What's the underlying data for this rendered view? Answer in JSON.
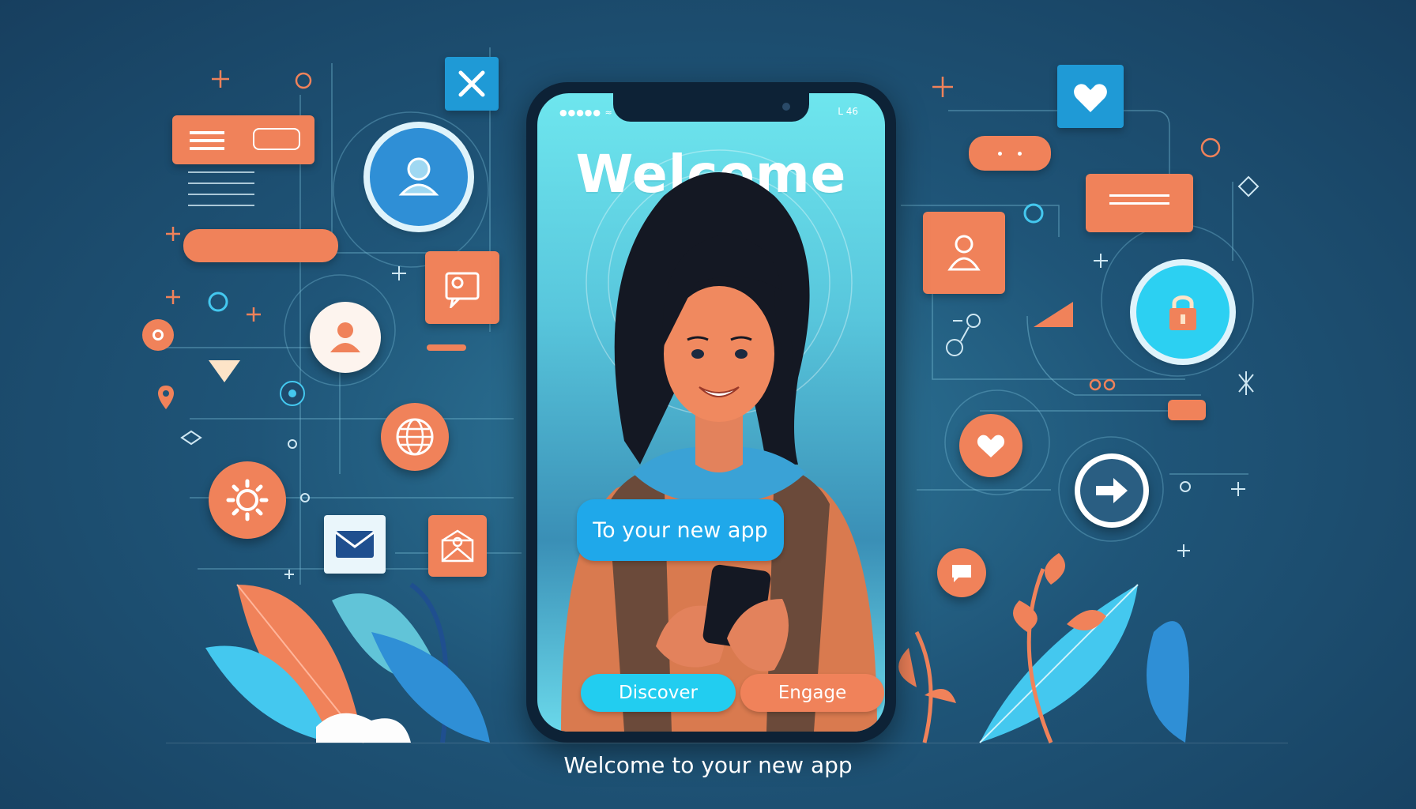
{
  "screen": {
    "title": "Welcome",
    "status_left": "●●●●● ≈",
    "status_right": "L 46",
    "bubble_text": "To your new app",
    "buttons": {
      "discover": "Discover",
      "engage": "Engage"
    }
  },
  "caption": "Welcome to your new app",
  "icons": [
    "close-icon",
    "user-icon",
    "chat-icon",
    "mail-icon",
    "envelope-icon",
    "settings-icon",
    "globe-icon",
    "location-pin-icon",
    "heart-icon",
    "lock-icon",
    "arrow-right-icon",
    "profile-icon",
    "plus-icon"
  ],
  "colors": {
    "accent_orange": "#f0825a",
    "accent_blue": "#1fa8ea",
    "accent_cyan": "#22cdf0",
    "background": "#1f5578"
  }
}
